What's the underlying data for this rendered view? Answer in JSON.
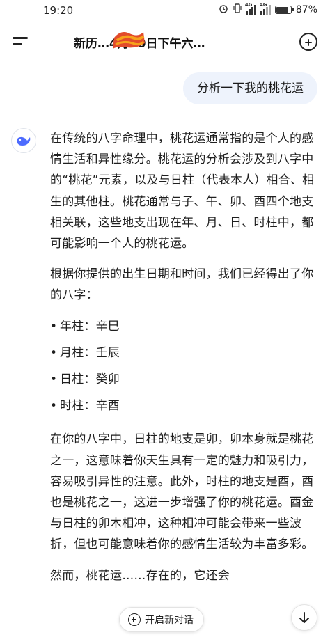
{
  "status_bar": {
    "time": "19:20",
    "signal_label_1": "4G",
    "signal_label_2": "4G",
    "battery_text": "87%",
    "battery_level": 0.87
  },
  "header": {
    "title": "新历…4月10日下午六…",
    "menu_icon": "menu-icon",
    "new_chat_icon": "new-chat-icon"
  },
  "user_message": "分析一下我的桃花运",
  "assistant": {
    "avatar_icon": "whale-logo-icon",
    "para1": "在传统的八字命理中，桃花运通常指的是个人的感情生活和异性缘分。桃花运的分析会涉及到八字中的“桃花”元素，以及与日柱（代表本人）相合、相生的其他柱。桃花通常与子、午、卯、酉四个地支相关联，这些地支出现在年、月、日、时柱中，都可能影响一个人的桃花运。",
    "para2": "根据你提供的出生日期和时间，我们已经得出了你的八字：",
    "bullets": [
      "年柱：辛巳",
      "月柱：壬辰",
      "日柱：癸卯",
      "时柱：辛酉"
    ],
    "para3": "在你的八字中，日柱的地支是卯，卯本身就是桃花之一，这意味着你天生具有一定的魅力和吸引力，容易吸引异性的注意。此外，时柱的地支是酉，酉也是桃花之一，这进一步增强了你的桃花运。酉金与日柱的卯木相冲，这种相冲可能会带来一些波折，但也可能意味着你的感情生活较为丰富多彩。",
    "para4_partial": "然而，桃花运……存在的，它还会"
  },
  "bottom": {
    "new_chat_label": "开启新对话",
    "scroll_down_icon": "arrow-down-icon"
  }
}
